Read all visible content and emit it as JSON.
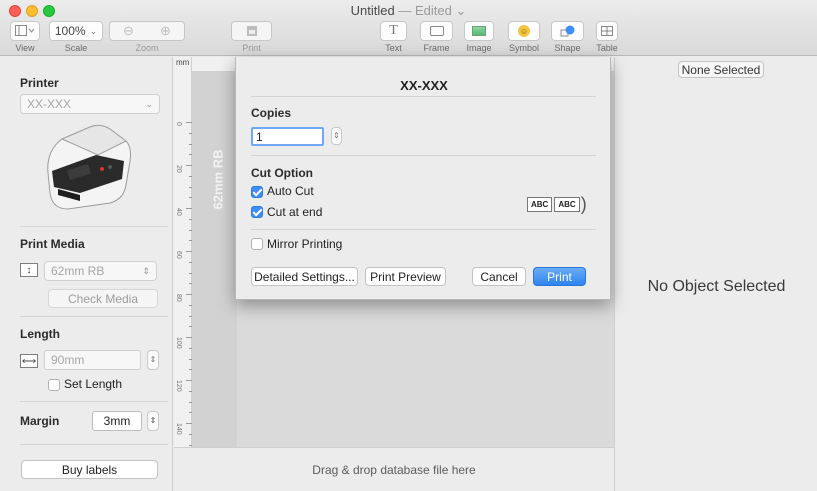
{
  "window": {
    "title": "Untitled",
    "edited": "— Edited ⌄"
  },
  "toolbar": {
    "view": "View",
    "scale_value": "100%",
    "scale": "Scale",
    "zoom": "Zoom",
    "print": "Print",
    "text": "Text",
    "frame": "Frame",
    "image": "Image",
    "symbol": "Symbol",
    "shape": "Shape",
    "table": "Table"
  },
  "left": {
    "printer_heading": "Printer",
    "printer_value": "XX-XXX",
    "media_heading": "Print Media",
    "media_value": "62mm RB",
    "check_media": "Check Media",
    "length_heading": "Length",
    "length_value": "90mm",
    "set_length": "Set Length",
    "margin_heading": "Margin",
    "margin_value": "3mm",
    "buy_labels": "Buy labels"
  },
  "canvas": {
    "ruler_unit": "mm",
    "ruler_marks": [
      "0",
      "20",
      "40",
      "60",
      "80",
      "100",
      "120",
      "140"
    ],
    "label_text": "62mm RB",
    "drop_hint": "Drag & drop database file here"
  },
  "right": {
    "selection_button": "None Selected",
    "no_object": "No Object Selected"
  },
  "dialog": {
    "title": "XX-XXX",
    "copies_heading": "Copies",
    "copies_value": "1",
    "cut_heading": "Cut Option",
    "auto_cut": "Auto Cut",
    "auto_cut_checked": true,
    "cut_at_end": "Cut at end",
    "cut_at_end_checked": true,
    "abc_left": "ABC",
    "abc_right": "ABC",
    "mirror": "Mirror Printing",
    "mirror_checked": false,
    "detailed": "Detailed Settings...",
    "preview": "Print Preview",
    "cancel": "Cancel",
    "print": "Print"
  },
  "colors": {
    "accent": "#3f8ef5",
    "close": "#fd5f57",
    "minimize": "#febc2e",
    "maximize": "#28c840"
  }
}
